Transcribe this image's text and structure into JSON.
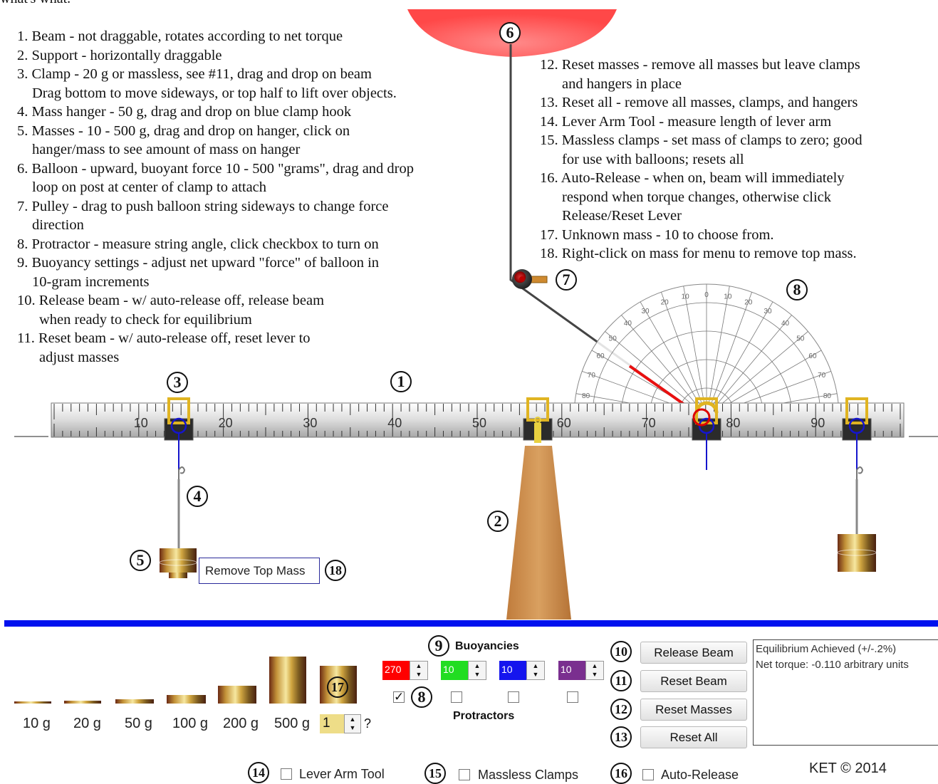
{
  "intro_fragment": "what's what.",
  "instructions_left": [
    {
      "num": "1.",
      "text": "Beam - not draggable, rotates according to net torque",
      "cont": ""
    },
    {
      "num": "2.",
      "text": "Support - horizontally draggable",
      "cont": ""
    },
    {
      "num": "3.",
      "text": "Clamp - 20 g or massless, see #11, drag and drop on beam",
      "cont": "Drag bottom to move sideways, or top half to lift over objects."
    },
    {
      "num": "4.",
      "text": "Mass hanger - 50 g, drag and drop on blue clamp hook",
      "cont": ""
    },
    {
      "num": "5.",
      "text": "Masses - 10 - 500 g, drag and drop on hanger, click on",
      "cont": "hanger/mass to see amount of mass on hanger"
    },
    {
      "num": "6.",
      "text": "Balloon - upward, buoyant force 10 - 500 \"grams\", drag and drop",
      "cont": "loop on post at center of clamp to attach"
    },
    {
      "num": "7.",
      "text": "Pulley - drag to push balloon string sideways to change force",
      "cont": "direction"
    },
    {
      "num": "8.",
      "text": "Protractor - measure string angle, click checkbox to turn on",
      "cont": ""
    },
    {
      "num": "9.",
      "text": "Buoyancy settings - adjust net upward \"force\" of balloon in",
      "cont": "10-gram increments"
    },
    {
      "num": "10.",
      "text": "Release beam - w/ auto-release off, release beam",
      "cont": "when ready to check for equilibrium"
    },
    {
      "num": "11.",
      "text": "Reset beam - w/ auto-release off, reset lever to",
      "cont": "adjust masses"
    }
  ],
  "instructions_right": [
    {
      "num": "12.",
      "text": "Reset masses - remove all masses but leave clamps",
      "cont": "and hangers in place"
    },
    {
      "num": "13.",
      "text": "Reset all - remove all masses, clamps, and hangers",
      "cont": ""
    },
    {
      "num": "14.",
      "text": "Lever Arm Tool - measure length of lever arm",
      "cont": ""
    },
    {
      "num": "15.",
      "text": "Massless clamps - set mass of clamps to zero; good",
      "cont": "for use with balloons; resets all"
    },
    {
      "num": "16.",
      "text": "Auto-Release - when on, beam will immediately",
      "cont": "respond when torque changes, otherwise click",
      "cont2": "Release/Reset Lever"
    },
    {
      "num": "17.",
      "text": "Unknown mass - 10 to choose from.",
      "cont": ""
    },
    {
      "num": "18.",
      "text": "Right-click on mass for menu to remove top mass.",
      "cont": ""
    }
  ],
  "callouts": [
    "1",
    "2",
    "3",
    "4",
    "5",
    "6",
    "7",
    "8",
    "8",
    "9",
    "10",
    "11",
    "12",
    "13",
    "14",
    "15",
    "16",
    "17",
    "18"
  ],
  "beam": {
    "ticks": [
      "10",
      "20",
      "30",
      "40",
      "50",
      "60",
      "70",
      "80",
      "90"
    ]
  },
  "protractor": {
    "labels": [
      "0",
      "10",
      "20",
      "30",
      "40",
      "50",
      "60",
      "70",
      "80"
    ]
  },
  "context_menu": {
    "remove_top_mass": "Remove Top Mass"
  },
  "buoyancy": {
    "title": "Buoyancies",
    "protractors_label": "Protractors",
    "values": [
      "270",
      "10",
      "10",
      "10"
    ],
    "colors": [
      "#ff0000",
      "#22dd22",
      "#1515ee",
      "#7a2f8f"
    ],
    "checked": [
      true,
      false,
      false,
      false
    ]
  },
  "mass_tray": {
    "labels": [
      "10 g",
      "20 g",
      "50 g",
      "100 g",
      "200 g",
      "500 g"
    ],
    "unknown_value": "1",
    "unknown_suffix": "?"
  },
  "buttons": {
    "release_beam": "Release Beam",
    "reset_beam": "Reset Beam",
    "reset_masses": "Reset Masses",
    "reset_all": "Reset All"
  },
  "status": {
    "line1": "Equilibrium Achieved  (+/-.2%)",
    "line2": "Net torque: -0.110  arbitrary units"
  },
  "options": {
    "lever_arm_tool": "Lever Arm Tool",
    "massless_clamps": "Massless Clamps",
    "auto_release": "Auto-Release"
  },
  "copyright": "KET © 2014",
  "colors": {
    "divider": "#0011ee",
    "balloon": "#ff5a5a",
    "clamp_gold": "#e0b422",
    "support": "#c98a48"
  }
}
